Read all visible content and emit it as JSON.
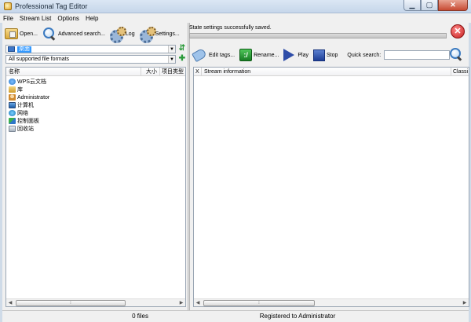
{
  "window": {
    "title": "Professional Tag Editor"
  },
  "menu": [
    "File",
    "Stream List",
    "Options",
    "Help"
  ],
  "left_toolbar": {
    "open": "Open...",
    "advanced_search": "Advanced search...",
    "log": "Log",
    "settings": "Settings..."
  },
  "browser": {
    "path_value": "桌面",
    "filter_value": "All supported file formats",
    "columns": [
      "名称",
      "大小",
      "项目类型"
    ],
    "items": [
      {
        "label": "WPS云文档",
        "icon": "cloud-icon"
      },
      {
        "label": "库",
        "icon": "library-icon"
      },
      {
        "label": "Administrator",
        "icon": "user-icon"
      },
      {
        "label": "计算机",
        "icon": "computer-icon"
      },
      {
        "label": "网络",
        "icon": "network-icon"
      },
      {
        "label": "控制面板",
        "icon": "control-panel-icon"
      },
      {
        "label": "回收站",
        "icon": "recycle-bin-icon"
      }
    ]
  },
  "status": {
    "message": "State settings successfully saved.",
    "progress": 0
  },
  "right_toolbar": {
    "edit_tags": "Edit tags...",
    "rename": "Rename...",
    "play": "Play",
    "stop": "Stop",
    "quick_search_label": "Quick search:",
    "quick_search_value": ""
  },
  "stream_list": {
    "columns": [
      "X",
      "Stream information",
      "Classi"
    ]
  },
  "statusbar": {
    "files": "0 files",
    "registration": "Registered to Administrator"
  }
}
